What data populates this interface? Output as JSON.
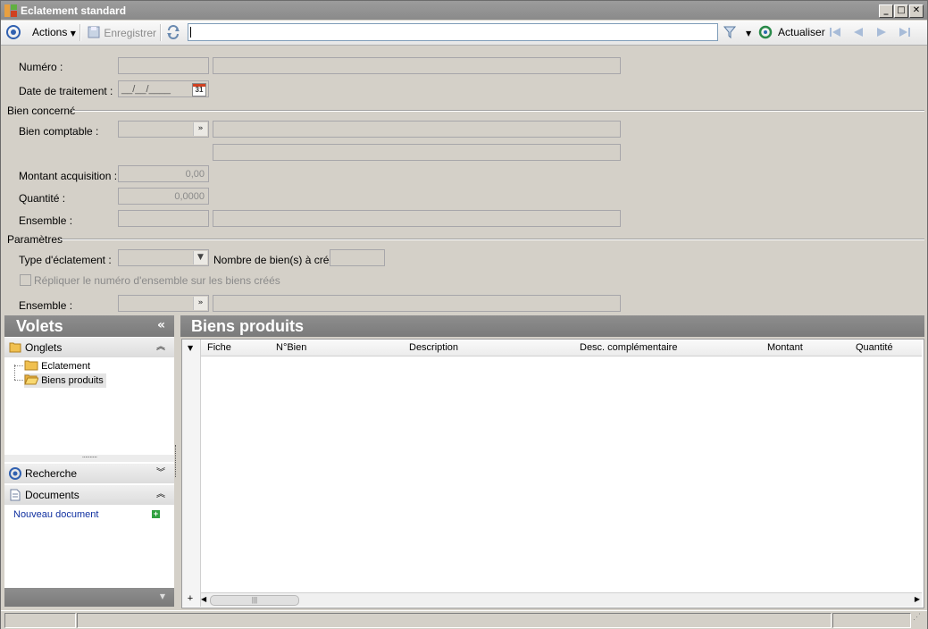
{
  "window": {
    "title": "Eclatement standard"
  },
  "toolbar": {
    "actions_label": "Actions",
    "save_label": "Enregistrer",
    "search_value": "",
    "refresh_label": "Actualiser"
  },
  "form": {
    "numero_label": "Numéro :",
    "date_label": "Date de traitement :",
    "date_value": "__/__/____",
    "calendar_day": "31",
    "bien_concerne_header": "Bien concerné",
    "bien_comptable_label": "Bien comptable :",
    "montant_label": "Montant acquisition :",
    "montant_value": "0,00",
    "quantite_label": "Quantité :",
    "quantite_value": "0,0000",
    "ensemble_label": "Ensemble :",
    "parametres_header": "Paramètres",
    "type_label": "Type d'éclatement :",
    "nombre_label": "Nombre de bien(s) à créer :",
    "repliquer_label": "Répliquer le numéro d'ensemble sur les biens créés",
    "ensemble2_label": "Ensemble :"
  },
  "volets": {
    "title": "Volets",
    "onglets_label": "Onglets",
    "tree": [
      {
        "label": "Eclatement"
      },
      {
        "label": "Biens produits"
      }
    ],
    "recherche_label": "Recherche",
    "documents_label": "Documents",
    "nouveau_document_label": "Nouveau document"
  },
  "biens": {
    "title": "Biens produits",
    "columns": [
      "Fiche",
      "N°Bien",
      "Description",
      "Desc. complémentaire",
      "Montant",
      "Quantité"
    ],
    "rows": []
  }
}
